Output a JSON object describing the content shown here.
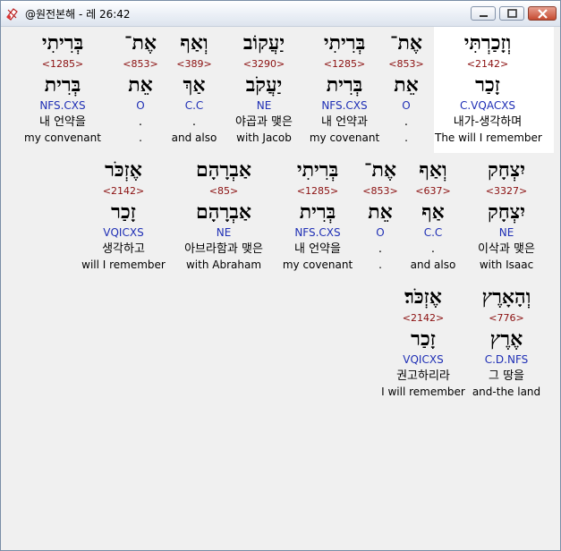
{
  "window": {
    "title": "@원전본해 - 레 26:42",
    "icon": "bible-app-icon"
  },
  "rows": [
    {
      "words": [
        {
          "heb": "וְזָכַרְתִּי",
          "strong": "<2142>",
          "lemma": "זָכַר",
          "morph": "C.VQACXS",
          "kor": "내가-생각하며",
          "eng": "The will I remember",
          "selected": true
        },
        {
          "heb": "אֶת־",
          "strong": "<853>",
          "lemma": "אֵת",
          "morph": "O",
          "kor": ".",
          "eng": ".",
          "selected": false
        },
        {
          "heb": "בְּרִיתִי",
          "strong": "<1285>",
          "lemma": "בְּרִית",
          "morph": "NFS.CXS",
          "kor": "내 언약과",
          "eng": "my covenant",
          "selected": false
        },
        {
          "heb": "יַעֲקוֹב",
          "strong": "<3290>",
          "lemma": "יַעֲקֹב",
          "morph": "NE",
          "kor": "야곱과 맺은",
          "eng": "with Jacob",
          "selected": false
        },
        {
          "heb": "וְאַף",
          "strong": "<389>",
          "lemma": "אַךְ",
          "morph": "C.C",
          "kor": ".",
          "eng": "and also",
          "selected": false
        },
        {
          "heb": "אֶת־",
          "strong": "<853>",
          "lemma": "אֵת",
          "morph": "O",
          "kor": ".",
          "eng": ".",
          "selected": false
        },
        {
          "heb": "בְּרִיתִי",
          "strong": "<1285>",
          "lemma": "בְּרִית",
          "morph": "NFS.CXS",
          "kor": "내 언약을",
          "eng": "my convenant",
          "selected": false
        }
      ]
    },
    {
      "words": [
        {
          "heb": "יִצְחָק",
          "strong": "<3327>",
          "lemma": "יִצְחָק",
          "morph": "NE",
          "kor": "이삭과 맺은",
          "eng": "with Isaac"
        },
        {
          "heb": "וְאַף",
          "strong": "<637>",
          "lemma": "אַף",
          "morph": "C.C",
          "kor": ".",
          "eng": "and also"
        },
        {
          "heb": "אֶת־",
          "strong": "<853>",
          "lemma": "אֵת",
          "morph": "O",
          "kor": ".",
          "eng": "."
        },
        {
          "heb": "בְּרִיתִי",
          "strong": "<1285>",
          "lemma": "בְּרִית",
          "morph": "NFS.CXS",
          "kor": "내 언약을",
          "eng": "my covenant"
        },
        {
          "heb": "אַבְרָהָם",
          "strong": "<85>",
          "lemma": "אַבְרָהָם",
          "morph": "NE",
          "kor": "아브라함과 맺은",
          "eng": "with Abraham"
        },
        {
          "heb": "אֶזְכֹּר",
          "strong": "<2142>",
          "lemma": "זָכַר",
          "morph": "VQICXS",
          "kor": "생각하고",
          "eng": "will I remember"
        }
      ]
    },
    {
      "words": [
        {
          "heb": "וְהָאָרֶץ",
          "strong": "<776>",
          "lemma": "אֶרֶץ",
          "morph": "C.D.NFS",
          "kor": "그 땅을",
          "eng": "and-the land"
        },
        {
          "heb": "אֶזְכֹּר׃",
          "strong": "<2142>",
          "lemma": "זָכַר",
          "morph": "VQICXS",
          "kor": "권고하리라",
          "eng": "I will remember"
        }
      ]
    }
  ]
}
